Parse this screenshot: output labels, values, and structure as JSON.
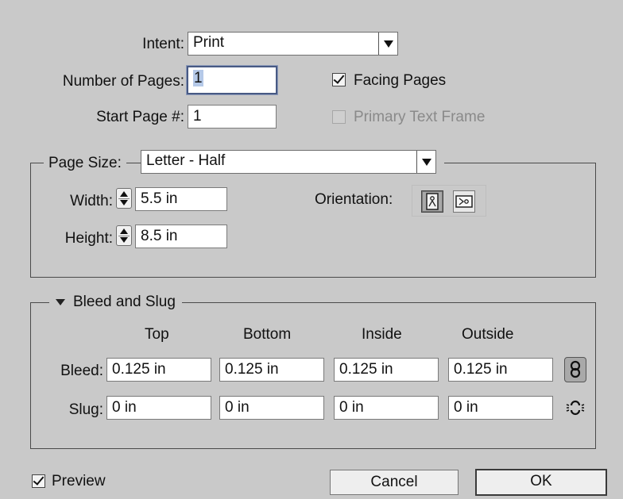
{
  "intent": {
    "label": "Intent:",
    "value": "Print"
  },
  "pages": {
    "label": "Number of Pages:",
    "value": "1"
  },
  "facing_pages": {
    "label": "Facing Pages",
    "checked": true
  },
  "start_page": {
    "label": "Start Page #:",
    "value": "1"
  },
  "primary_text_frame": {
    "label": "Primary Text Frame",
    "checked": false,
    "enabled": false
  },
  "page_size": {
    "label": "Page Size:",
    "value": "Letter - Half",
    "width_label": "Width:",
    "width_value": "5.5 in",
    "height_label": "Height:",
    "height_value": "8.5 in",
    "orientation_label": "Orientation:",
    "orientation_selected": "portrait"
  },
  "bleed_slug": {
    "title": "Bleed and Slug",
    "columns": [
      "Top",
      "Bottom",
      "Inside",
      "Outside"
    ],
    "bleed_label": "Bleed:",
    "bleed_values": [
      "0.125 in",
      "0.125 in",
      "0.125 in",
      "0.125 in"
    ],
    "slug_label": "Slug:",
    "slug_values": [
      "0 in",
      "0 in",
      "0 in",
      "0 in"
    ],
    "bleed_linked": true,
    "slug_linked": false
  },
  "preview": {
    "label": "Preview",
    "checked": true
  },
  "buttons": {
    "cancel": "Cancel",
    "ok": "OK"
  },
  "colors": {
    "background": "#c9c9c9",
    "focus_border": "#485a84",
    "selection": "#b5c9e8"
  }
}
